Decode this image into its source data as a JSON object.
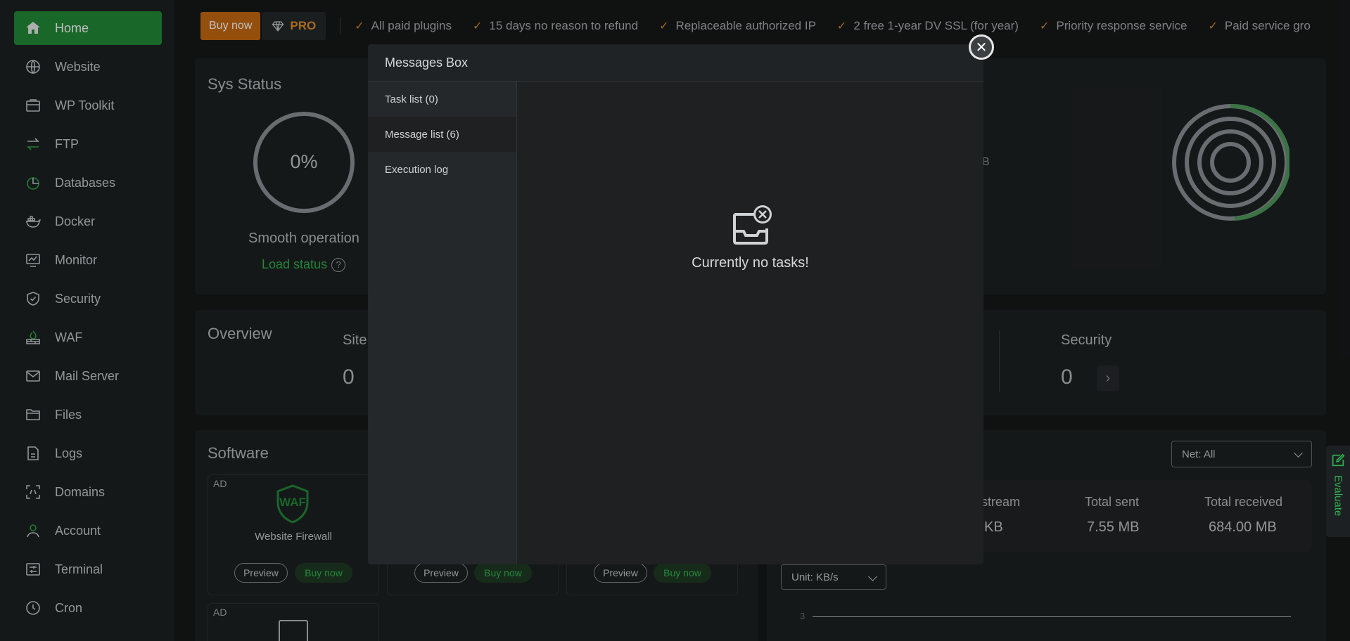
{
  "sidebar": {
    "items": [
      {
        "label": "Home",
        "icon": "home-icon"
      },
      {
        "label": "Website",
        "icon": "globe-icon"
      },
      {
        "label": "WP Toolkit",
        "icon": "toolkit-icon"
      },
      {
        "label": "FTP",
        "icon": "transfer-icon"
      },
      {
        "label": "Databases",
        "icon": "database-icon"
      },
      {
        "label": "Docker",
        "icon": "docker-icon"
      },
      {
        "label": "Monitor",
        "icon": "monitor-icon"
      },
      {
        "label": "Security",
        "icon": "shield-icon"
      },
      {
        "label": "WAF",
        "icon": "firewall-icon"
      },
      {
        "label": "Mail Server",
        "icon": "mail-icon"
      },
      {
        "label": "Files",
        "icon": "folder-icon"
      },
      {
        "label": "Logs",
        "icon": "log-icon"
      },
      {
        "label": "Domains",
        "icon": "domain-icon"
      },
      {
        "label": "Account",
        "icon": "user-icon"
      },
      {
        "label": "Terminal",
        "icon": "terminal-icon"
      },
      {
        "label": "Cron",
        "icon": "clock-icon"
      }
    ]
  },
  "topbar": {
    "buy_label": "Buy now",
    "pro_label": "PRO",
    "perks": [
      "All paid plugins",
      "15 days no reason to refund",
      "Replaceable authorized IP",
      "2 free 1-year DV SSL (for year)",
      "Priority response service",
      "Paid service gro"
    ]
  },
  "sys_status": {
    "title": "Sys Status",
    "load_value": "0%",
    "load_text": "Smooth operation",
    "load_status": "Load status"
  },
  "overview": {
    "title": "Overview",
    "site_label": "Site",
    "site_value": "0",
    "security_label": "Security",
    "security_value": "0"
  },
  "software": {
    "title": "Software",
    "cards": [
      {
        "ad": "AD",
        "name": "Website Firewall",
        "preview": "Preview",
        "buy": "Buy now"
      },
      {
        "ad": "",
        "name": "",
        "preview": "Preview",
        "buy": "Buy now"
      },
      {
        "ad": "",
        "name": "",
        "preview": "Preview",
        "buy": "Buy now"
      }
    ],
    "second_row_ad": "AD",
    "waf_logo_text": "WAF"
  },
  "traffic": {
    "net_select": "Net: All",
    "unit_select": "Unit: KB/s",
    "upstream_label": "stream",
    "upstream_value": "KB",
    "sent_label": "Total sent",
    "sent_value": "7.55 MB",
    "received_label": "Total received",
    "received_value": "684.00 MB",
    "axis_tick": "3"
  },
  "disk_partial": "B",
  "modal": {
    "title": "Messages Box",
    "tabs": [
      "Task list (0)",
      "Message list (6)",
      "Execution log"
    ],
    "empty_text": "Currently no tasks!"
  },
  "evaluate": {
    "label": "Evaluate"
  },
  "colors": {
    "accent": "#228a37",
    "pro": "#c66a12"
  }
}
